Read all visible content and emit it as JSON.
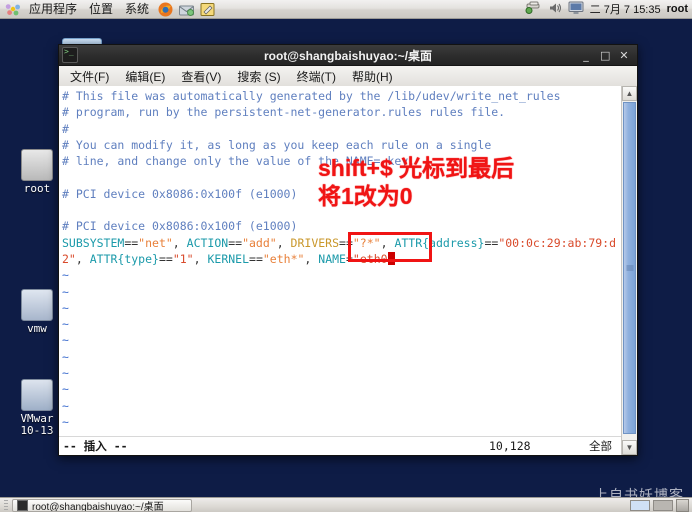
{
  "top_panel": {
    "menus": [
      "应用程序",
      "位置",
      "系统"
    ],
    "launchers": [
      "firefox-icon",
      "email-icon",
      "notes-icon"
    ],
    "tray": [
      "network-icon",
      "volume-icon",
      "display-icon"
    ],
    "clock": "二 7月  7 15:35",
    "user": "root"
  },
  "desktop": {
    "watermark": "上自书妖博客",
    "icons": [
      {
        "name": "root",
        "label": "root"
      },
      {
        "name": "vmware-tools",
        "label": "vmw"
      },
      {
        "name": "vmware-version",
        "label": "VMwar\n10-13"
      }
    ]
  },
  "terminal": {
    "title": "root@shangbaishuyao:~/桌面",
    "icon": "terminal-icon",
    "window_buttons": {
      "minimize": "_",
      "maximize": "□",
      "close": "✕"
    },
    "menus": [
      "文件(F)",
      "编辑(E)",
      "查看(V)",
      "搜索 (S)",
      "终端(T)",
      "帮助(H)"
    ],
    "lines": [
      "# This file was automatically generated by the /lib/udev/write_net_rules",
      "# program, run by the persistent-net-generator.rules rules file.",
      "#",
      "# You can modify it, as long as you keep each rule on a single",
      "# line, and change only the value of the NAME= key.",
      "",
      "# PCI device 0x8086:0x100f (e1000)",
      "",
      "# PCI device 0x8086:0x100f (e1000)"
    ],
    "rule_line_1": {
      "k1": "SUBSYSTEM",
      "op1": "==",
      "v1": "\"net\"",
      "sep1": ", ",
      "k2": "ACTION",
      "op2": "==",
      "v2": "\"add\"",
      "sep2": ", ",
      "k3": "DRIVERS",
      "op3": "==",
      "v3": "\"?*\"",
      "sep3": ", ",
      "k4": "ATTR{address}",
      "op4": "==",
      "v4": "\"00:0c:29:ab:79:d"
    },
    "rule_line_2": {
      "v4cont": "2\"",
      "sep0": ", ",
      "k5": "ATTR{type}",
      "op5": "==",
      "v5": "\"1\"",
      "sep5": ", ",
      "k6": "KERNEL",
      "op6": "==",
      "v6": "\"eth*\"",
      "sep6": ", ",
      "k7": "NAME",
      "op7": "=",
      "v7": "\"eth0",
      "v7end": "\""
    },
    "tilde": "~",
    "tilde_count": 12,
    "status": {
      "mode": "-- 插入 --",
      "position": "10,128",
      "percent": "全部"
    },
    "scrollbar": {
      "up": "▲",
      "down": "▼"
    }
  },
  "annotations": {
    "line1": "shift+$ 光标到最后",
    "line2": "将1改为0",
    "color": "#f01414",
    "highlight_target": "eth0"
  },
  "bottom_panel": {
    "task_label": "root@shangbaishuyao:~/桌面",
    "workspaces": [
      "ws-1",
      "ws-2"
    ],
    "trash": "trash-icon"
  }
}
